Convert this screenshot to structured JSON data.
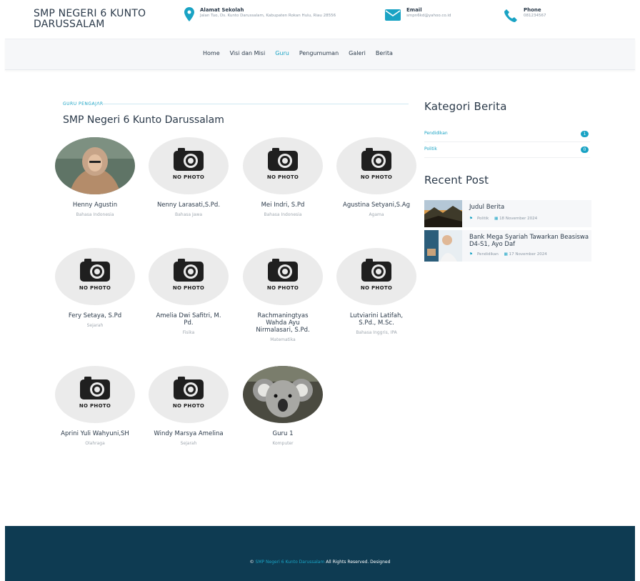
{
  "header": {
    "brand": "SMP NEGERI 6 KUNTO DARUSSALAM",
    "address": {
      "label": "Alamat Sekolah",
      "value": "Jalan Tuo, Ds. Kunto Darussalam, Kabupaten Rokan Hulu, Riau 28556"
    },
    "email": {
      "label": "Email",
      "value": "smpn6kd@yahoo.co.id"
    },
    "phone": {
      "label": "Phone",
      "value": "081234567"
    }
  },
  "nav": {
    "items": [
      {
        "label": "Home",
        "active": false
      },
      {
        "label": "Visi dan Misi",
        "active": false
      },
      {
        "label": "Guru",
        "active": true
      },
      {
        "label": "Pengumuman",
        "active": false
      },
      {
        "label": "Galeri",
        "active": false
      },
      {
        "label": "Berita",
        "active": false
      }
    ]
  },
  "main": {
    "eyebrow": "GURU PENGAJAR",
    "title": "SMP Negeri 6 Kunto Darussalam",
    "nophoto_label": "NO PHOTO",
    "teachers": [
      {
        "name": "Henny Agustin",
        "subject": "Bahasa Indonesia",
        "photo": "woman-hijab"
      },
      {
        "name": "Nenny Larasati,S.Pd.",
        "subject": "Bahasa Jawa",
        "photo": "none"
      },
      {
        "name": "Mei Indri, S.Pd",
        "subject": "Bahasa Indonesia",
        "photo": "none"
      },
      {
        "name": "Agustina Setyani,S.Ag",
        "subject": "Agama",
        "photo": "none"
      },
      {
        "name": "Fery Setaya, S.Pd",
        "subject": "Sejarah",
        "photo": "none"
      },
      {
        "name": "Amelia Dwi Safitri, M. Pd.",
        "subject": "Fisika",
        "photo": "none"
      },
      {
        "name": "Rachmaningtyas Wahda Ayu Nirmalasari, S.Pd.",
        "subject": "Matematika",
        "photo": "none"
      },
      {
        "name": "Lutviarini Latifah, S.Pd., M.Sc.",
        "subject": "Bahasa Inggris, IPA",
        "photo": "none"
      },
      {
        "name": "Aprini Yuli Wahyuni,SH",
        "subject": "Olahraga",
        "photo": "none"
      },
      {
        "name": "Windy Marsya Amelina",
        "subject": "Sejarah",
        "photo": "none"
      },
      {
        "name": "Guru 1",
        "subject": "Komputer",
        "photo": "koala"
      }
    ]
  },
  "sidebar": {
    "categories_title": "Kategori Berita",
    "categories": [
      {
        "label": "Pendidikan",
        "count": "1"
      },
      {
        "label": "Politik",
        "count": "0"
      }
    ],
    "recent_title": "Recent Post",
    "posts": [
      {
        "title": "Judul Berita",
        "category": "Politik",
        "date": "18 November 2024"
      },
      {
        "title": "Bank Mega Syariah Tawarkan Beasiswa D4-S1, Ayo Daf",
        "category": "Pendidikan",
        "date": "17 November 2024"
      }
    ]
  },
  "footer": {
    "copyright": "©",
    "brand": "SMP Negeri 6 Kunto Darussalam",
    "suffix": "All Rights Reserved. Designed"
  },
  "colors": {
    "accent": "#1aa3c4",
    "dark": "#2b3a4a",
    "footer": "#0e3b52"
  }
}
